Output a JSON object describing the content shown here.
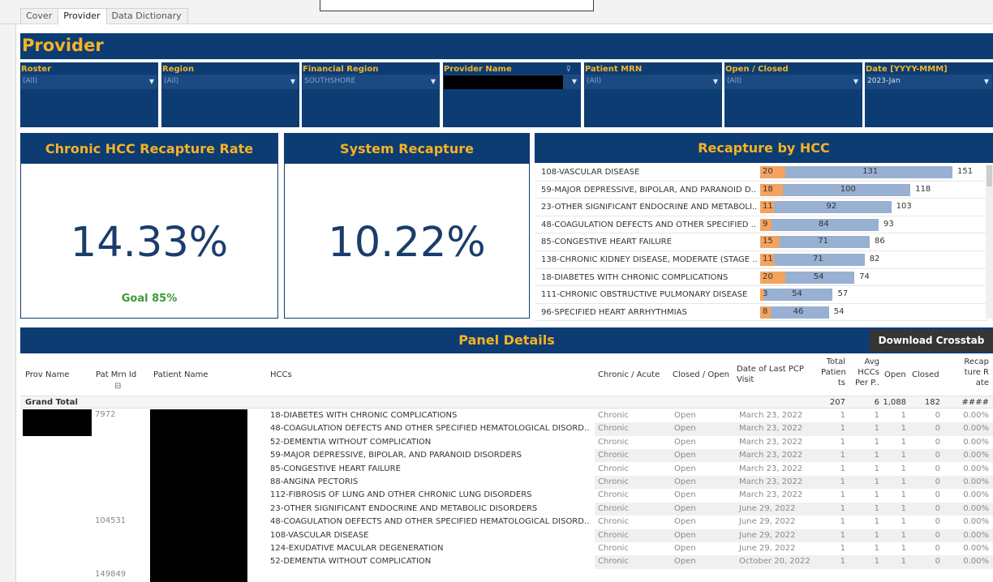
{
  "tabs": [
    "Cover",
    "Provider",
    "Data Dictionary"
  ],
  "header": {
    "title": "Provider"
  },
  "filters": [
    {
      "label": "Roster",
      "value": "(All)"
    },
    {
      "label": "Region",
      "value": "(All)"
    },
    {
      "label": "Financial Region",
      "value": "SOUTHSHORE"
    },
    {
      "label": "Provider Name",
      "value": ""
    },
    {
      "label": "Patient MRN",
      "value": "(All)"
    },
    {
      "label": "Open / Closed",
      "value": "(All)"
    },
    {
      "label": "Date [YYYY-MMM]",
      "value": "2023-Jan"
    }
  ],
  "kpi": {
    "chronic": {
      "title": "Chronic HCC Recapture Rate",
      "value": "14.33%",
      "goal": "Goal 85%"
    },
    "system": {
      "title": "System Recapture",
      "value": "10.22%"
    }
  },
  "hcc": {
    "title": "Recapture by HCC",
    "rows": [
      {
        "label": "108-VASCULAR DISEASE",
        "closed": 20,
        "open": 131,
        "total": 151
      },
      {
        "label": "59-MAJOR DEPRESSIVE, BIPOLAR, AND PARANOID D..",
        "closed": 18,
        "open": 100,
        "total": 118
      },
      {
        "label": "23-OTHER SIGNIFICANT ENDOCRINE AND METABOLI..",
        "closed": 11,
        "open": 92,
        "total": 103
      },
      {
        "label": "48-COAGULATION DEFECTS AND OTHER SPECIFIED ..",
        "closed": 9,
        "open": 84,
        "total": 93
      },
      {
        "label": "85-CONGESTIVE HEART FAILURE",
        "closed": 15,
        "open": 71,
        "total": 86
      },
      {
        "label": "138-CHRONIC KIDNEY DISEASE, MODERATE (STAGE ..",
        "closed": 11,
        "open": 71,
        "total": 82
      },
      {
        "label": "18-DIABETES WITH CHRONIC COMPLICATIONS",
        "closed": 20,
        "open": 54,
        "total": 74
      },
      {
        "label": "111-CHRONIC OBSTRUCTIVE PULMONARY DISEASE",
        "closed": 3,
        "open": 54,
        "total": 57
      },
      {
        "label": "96-SPECIFIED HEART ARRHYTHMIAS",
        "closed": 8,
        "open": 46,
        "total": 54
      }
    ],
    "colors": {
      "closed": "#f3a35f",
      "open": "#98b0d1"
    }
  },
  "panel": {
    "title": "Panel Details",
    "download_label": "Download Crosstab",
    "headers": {
      "prov": "Prov Name",
      "mrn": "Pat Mrn Id",
      "pat": "Patient Name",
      "hccs": "HCCs",
      "ca": "Chronic / Acute",
      "co": "Closed / Open",
      "pcp1": "Date of Last PCP",
      "pcp2": "Visit",
      "tp1": "Total",
      "tp2": "Patien",
      "tp3": "ts",
      "ah1": "Avg",
      "ah2": "HCCs",
      "ah3": "Per P..",
      "open": "Open",
      "closed": "Closed",
      "rr1": "Recap",
      "rr2": "ture R",
      "rr3": "ate"
    },
    "grand_total": {
      "label": "Grand Total",
      "total": "207",
      "avg": "6",
      "open": "1,088",
      "closed": "182",
      "rate": "####"
    },
    "mrns": [
      "7972",
      "104531",
      "149849"
    ],
    "rows": [
      {
        "hcc": "18-DIABETES WITH CHRONIC COMPLICATIONS",
        "ca": "Chronic",
        "co": "Open",
        "date": "March 23, 2022",
        "t": "1",
        "a": "1",
        "o": "1",
        "c": "0",
        "r": "0.00%"
      },
      {
        "hcc": "48-COAGULATION DEFECTS AND OTHER SPECIFIED HEMATOLOGICAL DISORD..",
        "ca": "Chronic",
        "co": "Open",
        "date": "March 23, 2022",
        "t": "1",
        "a": "1",
        "o": "1",
        "c": "0",
        "r": "0.00%"
      },
      {
        "hcc": "52-DEMENTIA WITHOUT COMPLICATION",
        "ca": "Chronic",
        "co": "Open",
        "date": "March 23, 2022",
        "t": "1",
        "a": "1",
        "o": "1",
        "c": "0",
        "r": "0.00%"
      },
      {
        "hcc": "59-MAJOR DEPRESSIVE, BIPOLAR, AND PARANOID DISORDERS",
        "ca": "Chronic",
        "co": "Open",
        "date": "March 23, 2022",
        "t": "1",
        "a": "1",
        "o": "1",
        "c": "0",
        "r": "0.00%"
      },
      {
        "hcc": "85-CONGESTIVE HEART FAILURE",
        "ca": "Chronic",
        "co": "Open",
        "date": "March 23, 2022",
        "t": "1",
        "a": "1",
        "o": "1",
        "c": "0",
        "r": "0.00%"
      },
      {
        "hcc": "88-ANGINA PECTORIS",
        "ca": "Chronic",
        "co": "Open",
        "date": "March 23, 2022",
        "t": "1",
        "a": "1",
        "o": "1",
        "c": "0",
        "r": "0.00%"
      },
      {
        "hcc": "112-FIBROSIS OF LUNG AND OTHER CHRONIC LUNG DISORDERS",
        "ca": "Chronic",
        "co": "Open",
        "date": "March 23, 2022",
        "t": "1",
        "a": "1",
        "o": "1",
        "c": "0",
        "r": "0.00%"
      },
      {
        "hcc": "23-OTHER SIGNIFICANT ENDOCRINE AND METABOLIC DISORDERS",
        "ca": "Chronic",
        "co": "Open",
        "date": "June 29, 2022",
        "t": "1",
        "a": "1",
        "o": "1",
        "c": "0",
        "r": "0.00%"
      },
      {
        "hcc": "48-COAGULATION DEFECTS AND OTHER SPECIFIED HEMATOLOGICAL DISORD..",
        "ca": "Chronic",
        "co": "Open",
        "date": "June 29, 2022",
        "t": "1",
        "a": "1",
        "o": "1",
        "c": "0",
        "r": "0.00%"
      },
      {
        "hcc": "108-VASCULAR DISEASE",
        "ca": "Chronic",
        "co": "Open",
        "date": "June 29, 2022",
        "t": "1",
        "a": "1",
        "o": "1",
        "c": "0",
        "r": "0.00%"
      },
      {
        "hcc": "124-EXUDATIVE MACULAR DEGENERATION",
        "ca": "Chronic",
        "co": "Open",
        "date": "June 29, 2022",
        "t": "1",
        "a": "1",
        "o": "1",
        "c": "0",
        "r": "0.00%"
      },
      {
        "hcc": "52-DEMENTIA WITHOUT COMPLICATION",
        "ca": "Chronic",
        "co": "Open",
        "date": "October 20, 2022",
        "t": "1",
        "a": "1",
        "o": "1",
        "c": "0",
        "r": "0.00%"
      }
    ]
  }
}
